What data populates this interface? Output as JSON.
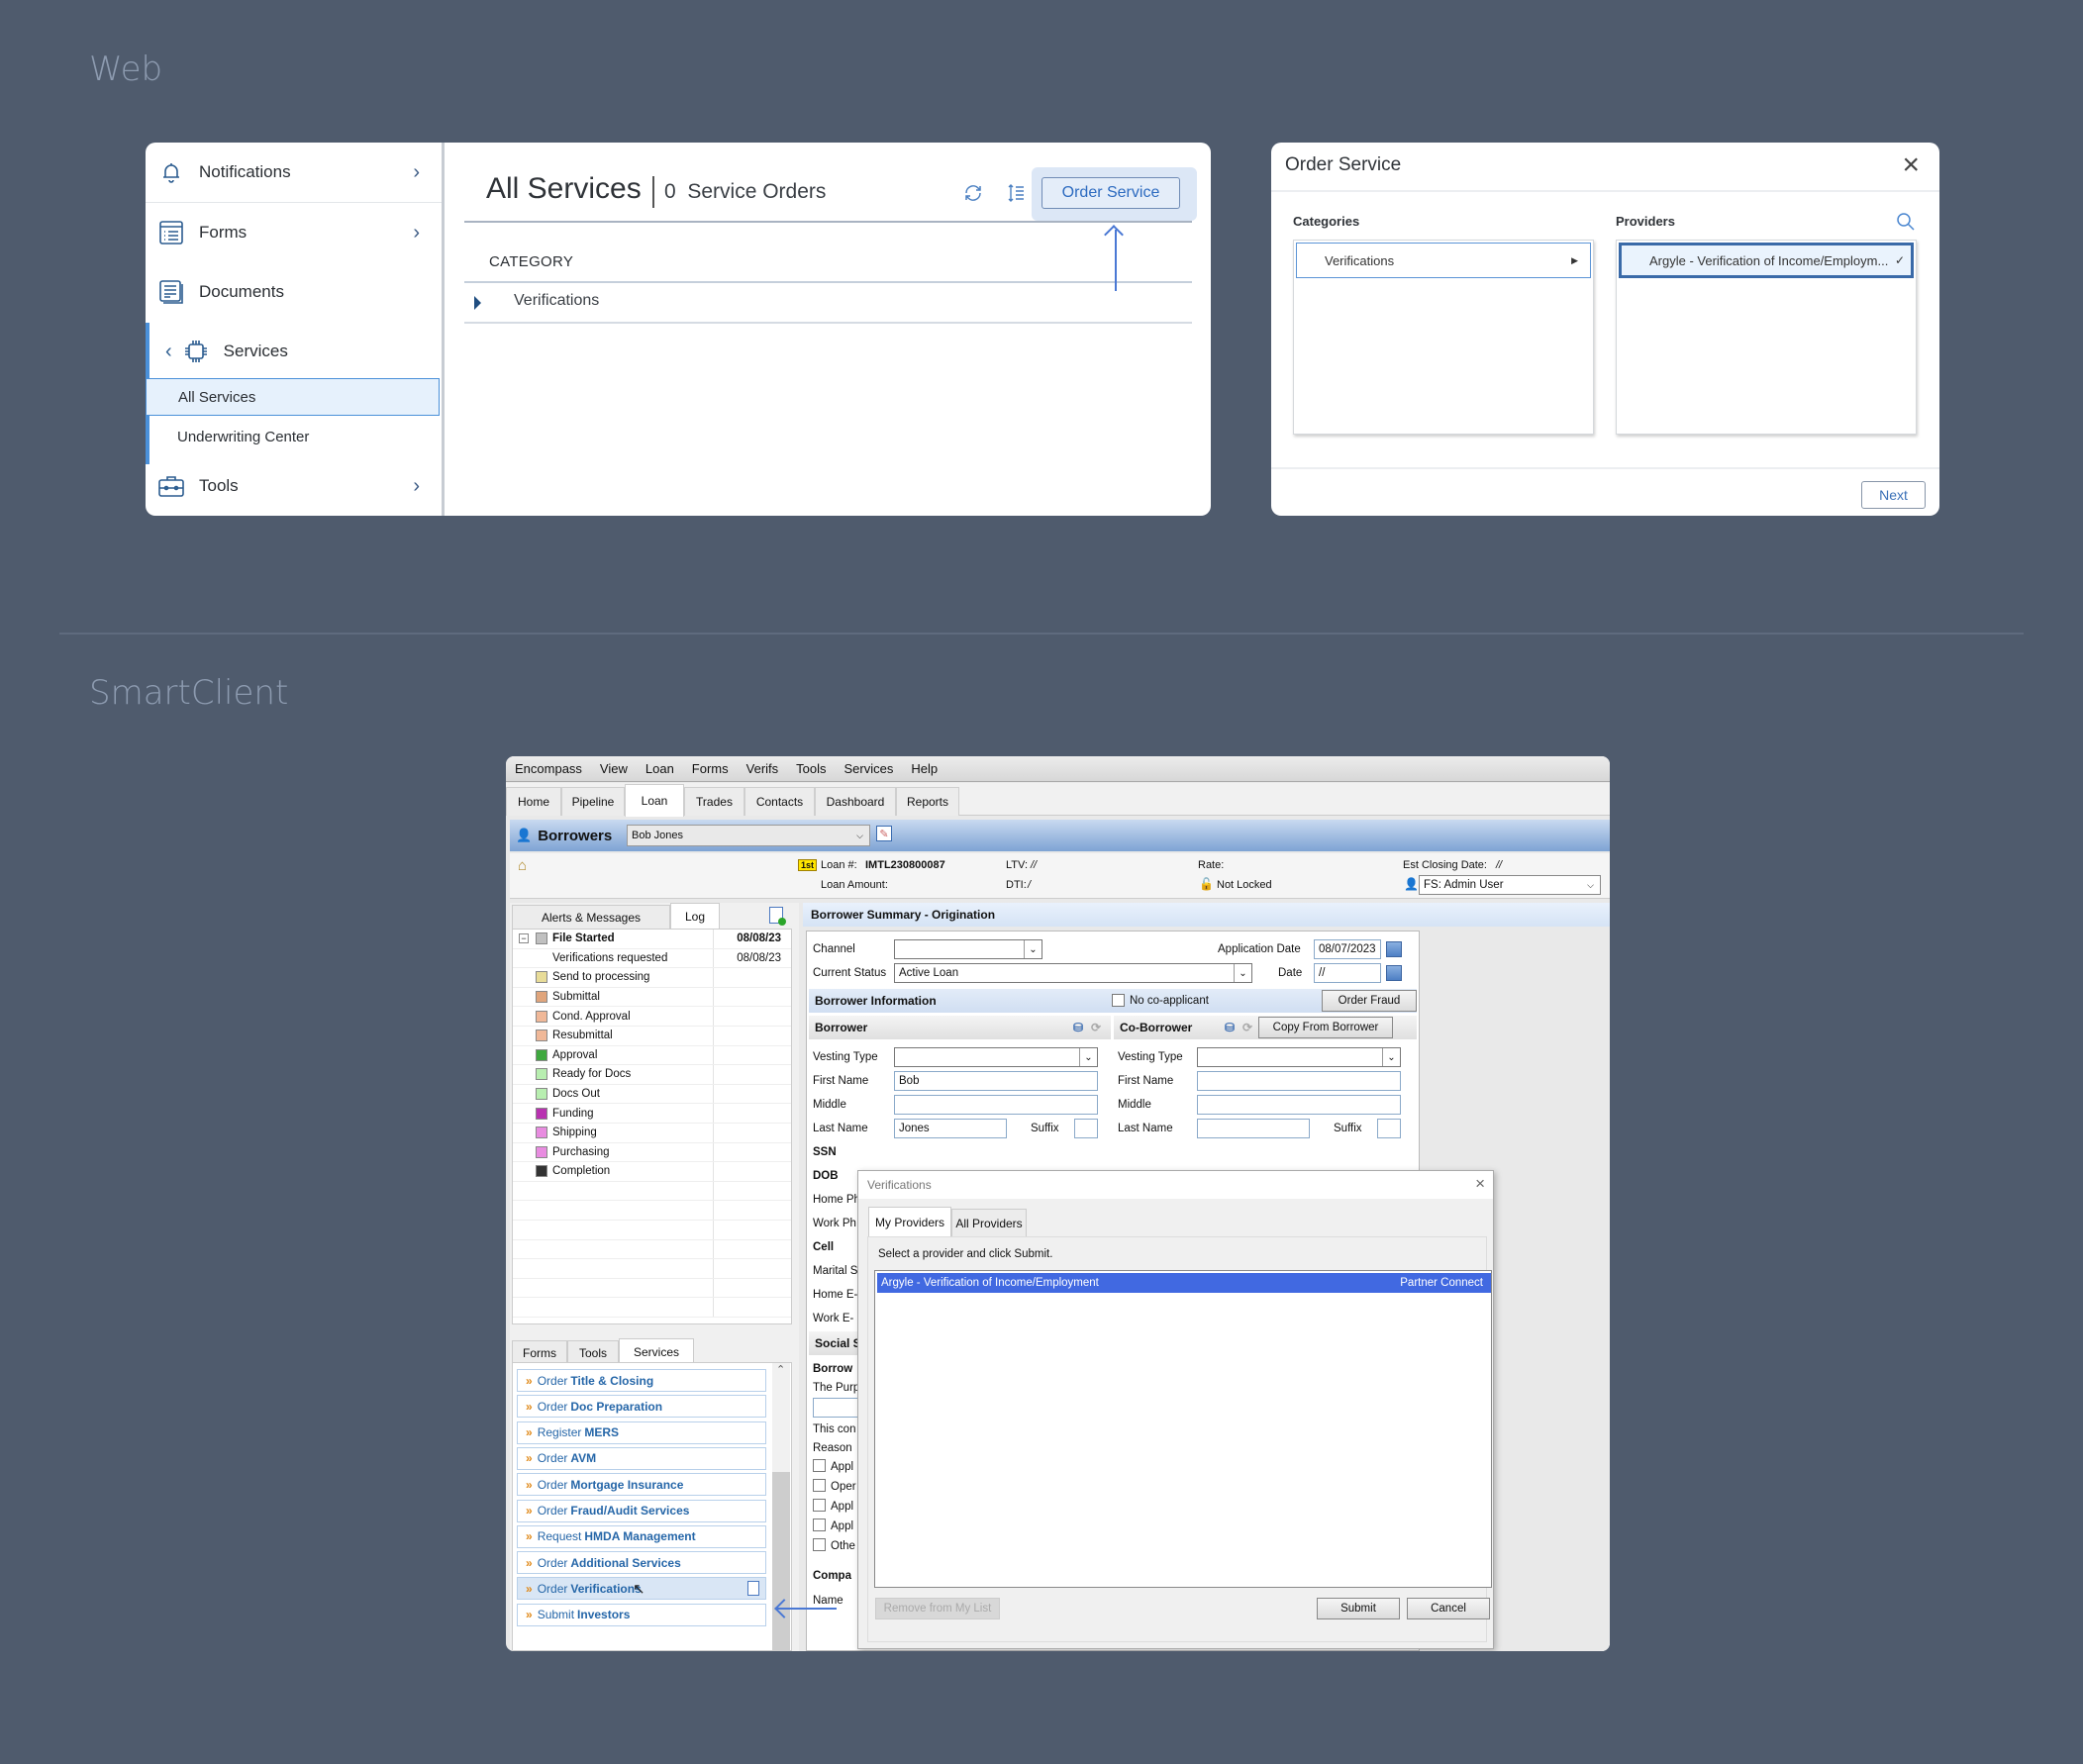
{
  "sections": {
    "web_title": "Web",
    "smartclient_title": "SmartClient"
  },
  "web": {
    "sidebar": {
      "items": [
        {
          "label": "Notifications",
          "icon": "bell-icon",
          "has_chevron": true
        },
        {
          "label": "Forms",
          "icon": "list-form-icon",
          "has_chevron": true
        },
        {
          "label": "Documents",
          "icon": "document-icon",
          "has_chevron": false
        },
        {
          "label": "Services",
          "icon": "chip-icon",
          "has_back": true
        },
        {
          "label": "Tools",
          "icon": "toolbox-icon",
          "has_chevron": true
        }
      ],
      "sub_items": [
        {
          "label": "All Services",
          "active": true
        },
        {
          "label": "Underwriting Center",
          "active": false
        }
      ]
    },
    "main": {
      "title": "All Services",
      "count": "0",
      "count_label": "Service Orders",
      "order_button": "Order Service",
      "column_header": "CATEGORY",
      "rows": [
        "Verifications"
      ]
    },
    "dialog": {
      "title": "Order Service",
      "categories_label": "Categories",
      "providers_label": "Providers",
      "category_item": "Verifications",
      "provider_item": "Argyle - Verification of Income/Employm...",
      "next_button": "Next"
    }
  },
  "smartclient": {
    "menu": [
      "Encompass",
      "View",
      "Loan",
      "Forms",
      "Verifs",
      "Tools",
      "Services",
      "Help"
    ],
    "tabs": [
      "Home",
      "Pipeline",
      "Loan",
      "Trades",
      "Contacts",
      "Dashboard",
      "Reports"
    ],
    "active_tab": "Loan",
    "borrowers_label": "Borrowers",
    "borrower_select": "Bob Jones",
    "info": {
      "lien": "1st",
      "loan_number_label": "Loan #:",
      "loan_number": "IMTL230800087",
      "loan_amount_label": "Loan Amount:",
      "ltv_label": "LTV:",
      "ltv_value": "//",
      "dti_label": "DTI:",
      "dti_value": "/",
      "rate_label": "Rate:",
      "lock_status": "Not Locked",
      "est_closing_label": "Est Closing Date:",
      "est_closing_value": "//",
      "user_select": "FS: Admin User"
    },
    "log_tabs": [
      "Alerts & Messages",
      "Log"
    ],
    "log": [
      {
        "name": "File Started",
        "date": "08/08/23",
        "bold": true,
        "color": "#c0c0c0"
      },
      {
        "name": "Verifications requested",
        "date": "08/08/23",
        "bold": false,
        "color": ""
      },
      {
        "name": "Send to processing",
        "date": "",
        "color": "#e8dc98"
      },
      {
        "name": "Submittal",
        "date": "",
        "color": "#e0a57c"
      },
      {
        "name": "Cond. Approval",
        "date": "",
        "color": "#f0b898"
      },
      {
        "name": "Resubmittal",
        "date": "",
        "color": "#f0b898"
      },
      {
        "name": "Approval",
        "date": "",
        "color": "#3fa83f"
      },
      {
        "name": "Ready for Docs",
        "date": "",
        "color": "#b8eeb0"
      },
      {
        "name": "Docs Out",
        "date": "",
        "color": "#b8eeb0"
      },
      {
        "name": "Funding",
        "date": "",
        "color": "#b832b0"
      },
      {
        "name": "Shipping",
        "date": "",
        "color": "#e88ce0"
      },
      {
        "name": "Purchasing",
        "date": "",
        "color": "#e88ce0"
      },
      {
        "name": "Completion",
        "date": "",
        "color": "#333333"
      }
    ],
    "services_tabs": [
      "Forms",
      "Tools",
      "Services"
    ],
    "services": [
      {
        "prefix": "Order",
        "bold": "Title & Closing"
      },
      {
        "prefix": "Order",
        "bold": "Doc Preparation"
      },
      {
        "prefix": "Register",
        "bold": "MERS"
      },
      {
        "prefix": "Order",
        "bold": "AVM"
      },
      {
        "prefix": "Order",
        "bold": "Mortgage Insurance"
      },
      {
        "prefix": "Order",
        "bold": "Fraud/Audit Services"
      },
      {
        "prefix": "Request",
        "bold": "HMDA Management"
      },
      {
        "prefix": "Order",
        "bold": "Additional Services"
      },
      {
        "prefix": "Order",
        "bold": "Verifications"
      },
      {
        "prefix": "Submit",
        "bold": "Investors"
      }
    ],
    "form": {
      "header": "Borrower Summary - Origination",
      "channel_label": "Channel",
      "channel_value": "",
      "status_label": "Current Status",
      "status_value": "Active Loan",
      "app_date_label": "Application Date",
      "app_date_value": "08/07/2023",
      "date_label": "Date",
      "date_value": "//",
      "borrower_info": "Borrower Information",
      "no_coapplicant": "No co-applicant",
      "order_fraud": "Order Fraud",
      "borrower": "Borrower",
      "co_borrower": "Co-Borrower",
      "copy_from_borrower": "Copy From Borrower",
      "vesting_type": "Vesting Type",
      "first_name": "First Name",
      "first_name_value": "Bob",
      "middle": "Middle",
      "last_name": "Last Name",
      "last_name_value": "Jones",
      "suffix": "Suffix",
      "left_labels": [
        "SSN",
        "DOB",
        "Home Ph",
        "Work Ph",
        "Cell",
        "Marital S",
        "Home E-",
        "Work E-"
      ],
      "social_section": "Social S",
      "borrow_label": "Borrow",
      "purp_label": "The Purp",
      "this_con": "This con",
      "reason": "Reason",
      "checks": [
        "Appl",
        "Oper",
        "Appl",
        "Appl",
        "Othe"
      ],
      "company_label": "Compa",
      "name_label": "Name"
    },
    "verif_dialog": {
      "title": "Verifications",
      "tabs": [
        "My Providers",
        "All Providers"
      ],
      "instruction": "Select a provider and click Submit.",
      "provider": "Argyle - Verification of Income/Employment",
      "provider_type": "Partner Connect",
      "remove_button": "Remove from My List",
      "submit_button": "Submit",
      "cancel_button": "Cancel"
    }
  }
}
